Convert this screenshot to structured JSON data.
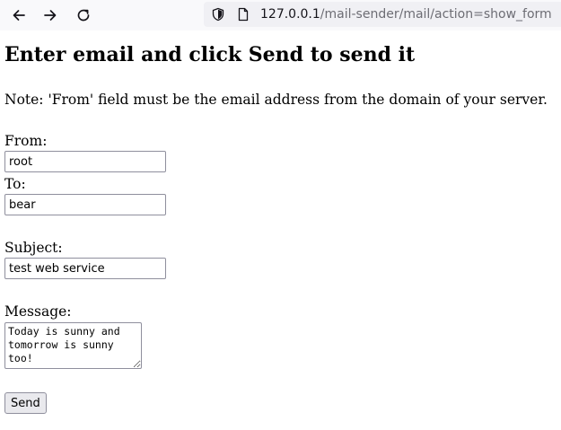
{
  "browser": {
    "back_icon": "arrow-left-icon",
    "forward_icon": "arrow-right-icon",
    "reload_icon": "reload-icon",
    "url_host": "127.0.0.1",
    "url_path": "/mail-sender/mail/action=show_form",
    "colors": {
      "toolbar_bg": "#f9f9fb",
      "urlbar_bg": "#f0f0f4",
      "url_path": "#6d6d74"
    }
  },
  "page": {
    "title": "Enter email and click Send to send it",
    "note": "Note: 'From' field must be the email address from the domain of your server."
  },
  "form": {
    "from_label": "From:",
    "from_value": "root",
    "to_label": "To:",
    "to_value": "bear",
    "subject_label": "Subject:",
    "subject_value": "test web service",
    "message_label": "Message:",
    "message_value": "Today is sunny and tomorrow is sunny too!",
    "send_label": "Send"
  }
}
